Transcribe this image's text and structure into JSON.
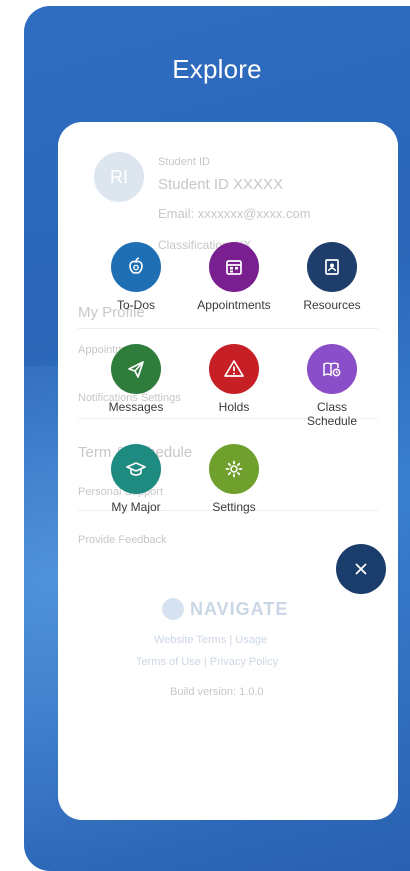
{
  "header": {
    "title": "Explore"
  },
  "profile": {
    "initials": "RI",
    "line1": "Student ID",
    "student_id": "Student ID XXXXX",
    "email": "Email: xxxxxxx@xxxx.com",
    "classification": "Classification: XX"
  },
  "background_rows": [
    "My Profile",
    "Appointments",
    "Notifications Settings",
    "Term & Schedule",
    "Personal Support",
    "Provide Feedback"
  ],
  "footer": {
    "logo_text": "NAVIGATE",
    "links_1": "Website Terms  |  Usage",
    "links_2": "Terms of Use  |  Privacy Policy",
    "build": "Build version: 1.0.0"
  },
  "menu": {
    "items": [
      {
        "label": "To-Dos",
        "icon": "apple-icon",
        "color": "#1f6fb4"
      },
      {
        "label": "Appointments",
        "icon": "calendar-icon",
        "color": "#7a1f8f"
      },
      {
        "label": "Resources",
        "icon": "contact-book-icon",
        "color": "#1e3d6a"
      },
      {
        "label": "Messages",
        "icon": "paper-plane-icon",
        "color": "#2f7d3b"
      },
      {
        "label": "Holds",
        "icon": "warning-icon",
        "color": "#c61f25"
      },
      {
        "label": "Class\nSchedule",
        "label_line1": "Class",
        "label_line2": "Schedule",
        "icon": "schedule-book-icon",
        "color": "#8a4ec8"
      },
      {
        "label": "My Major",
        "icon": "graduation-cap-icon",
        "color": "#1f8a80"
      },
      {
        "label": "Settings",
        "icon": "gear-icon",
        "color": "#6f9f2c"
      }
    ],
    "close_label": "×"
  }
}
